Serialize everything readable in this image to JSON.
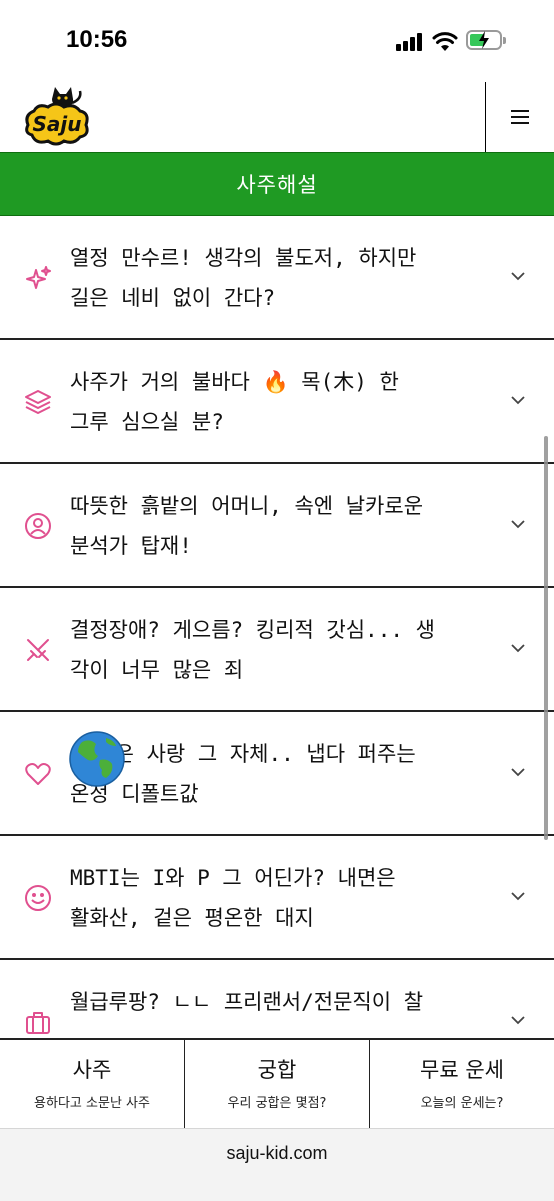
{
  "status": {
    "time": "10:56"
  },
  "header": {
    "logo_text": "Saju"
  },
  "title": "사주해설",
  "items": [
    {
      "text": "열정 만수르! 생각의 불도저, 하지만\n길은 네비 없이 간다?",
      "icon": "sparkles-icon"
    },
    {
      "text": "사주가 거의 불바다 🔥 목(木) 한\n그루 심으실 분?",
      "icon": "layers-icon"
    },
    {
      "text": "따뜻한 흙밭의 어머니, 속엔 날카로운\n분석가 탑재!",
      "icon": "user-circle-icon"
    },
    {
      "text": "결정장애? 게으름? 킹리적 갓심... 생\n각이 너무 많은 죄",
      "icon": "swords-icon"
    },
    {
      "text": "  님은 사랑 그 자체.. 냅다 퍼주는\n온정 디폴트값",
      "icon": "heart-icon"
    },
    {
      "text": "MBTI는 I와 P 그 어딘가? 내면은\n활화산, 겉은 평온한 대지",
      "icon": "smile-icon"
    },
    {
      "text": "월급루팡? ㄴㄴ 프리랜서/전문직이 찰",
      "icon": "briefcase-icon"
    }
  ],
  "bottom_nav": [
    {
      "title": "사주",
      "subtitle": "용하다고 소문난 사주"
    },
    {
      "title": "궁합",
      "subtitle": "우리 궁합은 몇점?"
    },
    {
      "title": "무료 운세",
      "subtitle": "오늘의 운세는?"
    }
  ],
  "browser": {
    "url": "saju-kid.com"
  },
  "colors": {
    "accent_green": "#1f9a23",
    "icon_pink": "#e0508f",
    "logo_yellow": "#f5c518"
  }
}
